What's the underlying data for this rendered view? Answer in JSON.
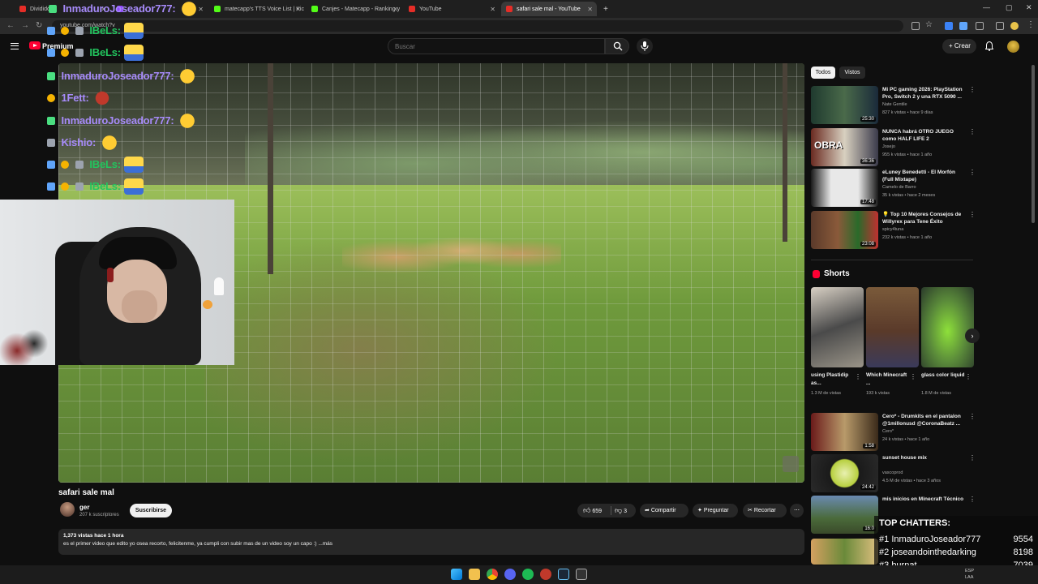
{
  "browser": {
    "tabs": [
      {
        "label": "Dividido",
        "active": false,
        "color": "#e52d27"
      },
      {
        "label": "",
        "active": false,
        "color": "#9146ff"
      },
      {
        "label": "matecapp's TTS Voice List | Kic",
        "active": false,
        "color": "#53fc18"
      },
      {
        "label": "Canjes - Matecapp - Ranking y",
        "active": false,
        "color": "#53fc18"
      },
      {
        "label": "YouTube",
        "active": false,
        "color": "#e52d27"
      },
      {
        "label": "safari sale mal - YouTube",
        "active": true,
        "color": "#e52d27"
      }
    ],
    "url": "youtube.com/watch?v"
  },
  "header": {
    "premium_label": "Premium",
    "search_placeholder": "Buscar",
    "create_label": "+ Crear"
  },
  "video": {
    "title": "safari sale mal",
    "channel_name": "ger",
    "subscribers": "207 k suscriptores",
    "subscribe_label": "Suscribirse",
    "likes": "659",
    "dislikes": "3",
    "share_label": "Compartir",
    "ask_label": "Preguntar",
    "clip_label": "Recortar",
    "description_meta": "1,373 vistas  hace 1 hora",
    "description_text": "es el primer video que edito yo osea recorto, felicitenme, ya cumpli con subir mas de un video soy un capo :)  ...más"
  },
  "sidebar": {
    "chips": [
      "Todos",
      "Vistos"
    ],
    "recommendations": [
      {
        "title": "Mi PC gaming 2026: PlayStation Pro, Switch 2 y una RTX 5090 ...",
        "channel": "Nate Gentile",
        "meta": "827 k vistas • hace 9 días",
        "duration": "25:30"
      },
      {
        "title": "NUNCA habrá OTRO JUEGO como HALF LIFE 2",
        "channel": "Josejo",
        "meta": "955 k vistas • hace 1 año",
        "duration": "36:36"
      },
      {
        "title": "eLuney Benedetti - El Morfón (Full Mixtape)",
        "channel": "Camelo de Barro",
        "meta": "35 k vistas • hace 2 meses",
        "duration": "17:48"
      },
      {
        "title": "💡 Top 10 Mejores Consejos de Willyrex para Tene Éxito",
        "channel": "spicy4tuna",
        "meta": "232 k vistas • hace 1 año",
        "duration": "23:08"
      }
    ],
    "shorts_title": "Shorts",
    "shorts": [
      {
        "title": "using Plastidip as...",
        "views": "1.3 M de vistas"
      },
      {
        "title": "Which Minecraft ...",
        "views": "193 k vistas"
      },
      {
        "title": "glass color liquid",
        "views": "1.8 M de vistas"
      }
    ],
    "recommendations_2": [
      {
        "title": "Cero* - Drumkits en el pantalon @1millonusd @CoronaBeatz ...",
        "channel": "Cero*",
        "meta": "24 k vistas • hace 1 año",
        "duration": "1:58"
      },
      {
        "title": "sunset house mix",
        "channel": "vascoprod",
        "meta": "4.5 M de vistas • hace 3 años",
        "duration": "24:42"
      },
      {
        "title": "mis inicios en Minecraft Técnico",
        "channel": "",
        "meta": "",
        "duration": "16:0"
      }
    ]
  },
  "chat_overlay": {
    "lines": [
      {
        "name": "InmaduroJoseador777:",
        "color": "#a78bfa"
      },
      {
        "name": "IBeLs:",
        "color": "#22c55e"
      },
      {
        "name": "IBeLs:",
        "color": "#22c55e"
      },
      {
        "name": "InmaduroJoseador777:",
        "color": "#a78bfa"
      },
      {
        "name": "1Fett:",
        "color": "#a78bfa"
      },
      {
        "name": "InmaduroJoseador777:",
        "color": "#a78bfa"
      },
      {
        "name": "Kishio:",
        "color": "#a78bfa"
      },
      {
        "name": "IBeLs:",
        "color": "#22c55e"
      },
      {
        "name": "IBeLs:",
        "color": "#22c55e"
      }
    ]
  },
  "top_chatters": {
    "title": "TOP CHATTERS:",
    "rows": [
      {
        "rank": "#1",
        "name": "InmaduroJoseador777",
        "count": "9554"
      },
      {
        "rank": "#2",
        "name": "joseandointhedarking",
        "count": "8198"
      },
      {
        "rank": "#3",
        "name": "burnat",
        "count": "7039"
      }
    ]
  },
  "taskbar": {
    "tray_lang": "ESP\nLAA"
  },
  "colors": {
    "brand_red": "#ff0033",
    "background": "#0f0f0f",
    "surface": "#272727"
  }
}
